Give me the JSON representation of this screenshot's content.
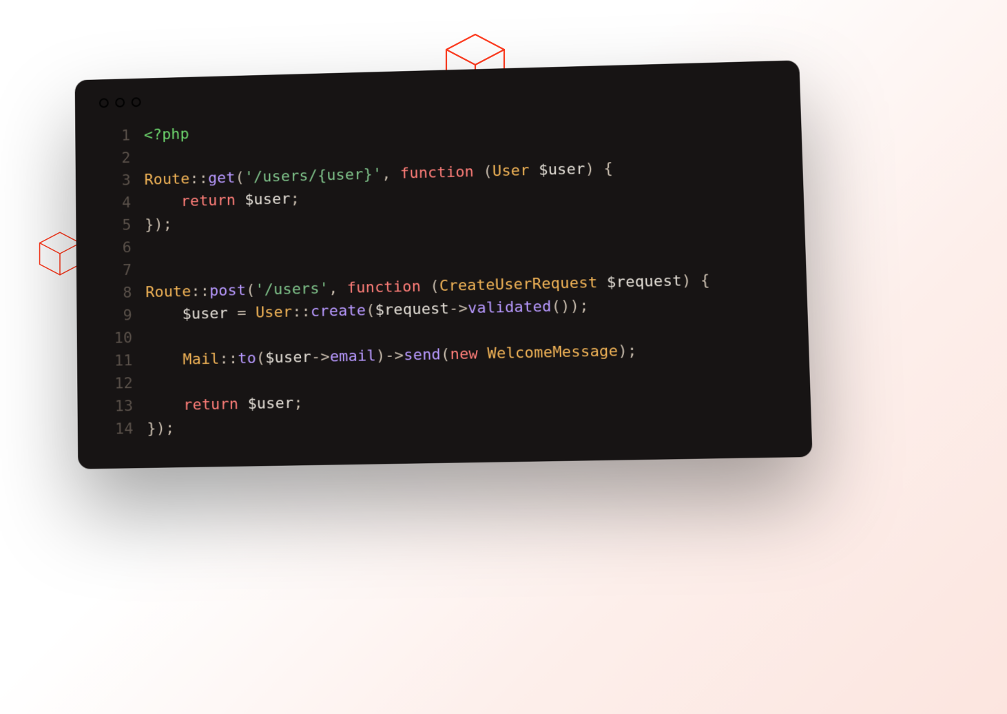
{
  "traffic_lights": {
    "red": "close",
    "yellow": "minimize",
    "green": "zoom"
  },
  "syntax_colors": {
    "tag": "#6dd66d",
    "class": "#f2b457",
    "method": "#b899ff",
    "string": "#7fc28a",
    "keyword": "#ff7e79",
    "var": "#e4dfd7",
    "op": "#cbbfb0",
    "plain": "#ddd6ce"
  },
  "editor": {
    "background": "#171414",
    "lines": [
      {
        "n": 1,
        "tokens": [
          [
            "tag",
            "<?php"
          ]
        ]
      },
      {
        "n": 2,
        "tokens": [
          [
            "plain",
            ""
          ]
        ]
      },
      {
        "n": 3,
        "tokens": [
          [
            "class",
            "Route"
          ],
          [
            "op",
            "::"
          ],
          [
            "method",
            "get"
          ],
          [
            "op",
            "("
          ],
          [
            "string",
            "'/users/{user}'"
          ],
          [
            "op",
            ", "
          ],
          [
            "keyword",
            "function"
          ],
          [
            "plain",
            " "
          ],
          [
            "op",
            "("
          ],
          [
            "class",
            "User"
          ],
          [
            "plain",
            " "
          ],
          [
            "var",
            "$user"
          ],
          [
            "op",
            ")"
          ],
          [
            "plain",
            " "
          ],
          [
            "op",
            "{"
          ]
        ]
      },
      {
        "n": 4,
        "tokens": [
          [
            "plain",
            "    "
          ],
          [
            "keyword",
            "return"
          ],
          [
            "plain",
            " "
          ],
          [
            "var",
            "$user"
          ],
          [
            "op",
            ";"
          ]
        ]
      },
      {
        "n": 5,
        "tokens": [
          [
            "op",
            "});"
          ]
        ]
      },
      {
        "n": 6,
        "tokens": [
          [
            "plain",
            ""
          ]
        ]
      },
      {
        "n": 7,
        "tokens": [
          [
            "plain",
            ""
          ]
        ]
      },
      {
        "n": 8,
        "tokens": [
          [
            "class",
            "Route"
          ],
          [
            "op",
            "::"
          ],
          [
            "method",
            "post"
          ],
          [
            "op",
            "("
          ],
          [
            "string",
            "'/users'"
          ],
          [
            "op",
            ", "
          ],
          [
            "keyword",
            "function"
          ],
          [
            "plain",
            " "
          ],
          [
            "op",
            "("
          ],
          [
            "class",
            "CreateUserRequest"
          ],
          [
            "plain",
            " "
          ],
          [
            "var",
            "$request"
          ],
          [
            "op",
            ")"
          ],
          [
            "plain",
            " "
          ],
          [
            "op",
            "{"
          ]
        ]
      },
      {
        "n": 9,
        "tokens": [
          [
            "plain",
            "    "
          ],
          [
            "var",
            "$user"
          ],
          [
            "plain",
            " "
          ],
          [
            "op",
            "="
          ],
          [
            "plain",
            " "
          ],
          [
            "class",
            "User"
          ],
          [
            "op",
            "::"
          ],
          [
            "method",
            "create"
          ],
          [
            "op",
            "("
          ],
          [
            "var",
            "$request"
          ],
          [
            "op",
            "->"
          ],
          [
            "method",
            "validated"
          ],
          [
            "op",
            "());"
          ]
        ]
      },
      {
        "n": 10,
        "tokens": [
          [
            "plain",
            ""
          ]
        ]
      },
      {
        "n": 11,
        "tokens": [
          [
            "plain",
            "    "
          ],
          [
            "class",
            "Mail"
          ],
          [
            "op",
            "::"
          ],
          [
            "method",
            "to"
          ],
          [
            "op",
            "("
          ],
          [
            "var",
            "$user"
          ],
          [
            "op",
            "->"
          ],
          [
            "method",
            "email"
          ],
          [
            "op",
            ")->"
          ],
          [
            "method",
            "send"
          ],
          [
            "op",
            "("
          ],
          [
            "keyword",
            "new"
          ],
          [
            "plain",
            " "
          ],
          [
            "class",
            "WelcomeMessage"
          ],
          [
            "op",
            ");"
          ]
        ]
      },
      {
        "n": 12,
        "tokens": [
          [
            "plain",
            ""
          ]
        ]
      },
      {
        "n": 13,
        "tokens": [
          [
            "plain",
            "    "
          ],
          [
            "keyword",
            "return"
          ],
          [
            "plain",
            " "
          ],
          [
            "var",
            "$user"
          ],
          [
            "op",
            ";"
          ]
        ]
      },
      {
        "n": 14,
        "tokens": [
          [
            "op",
            "});"
          ]
        ]
      }
    ]
  }
}
